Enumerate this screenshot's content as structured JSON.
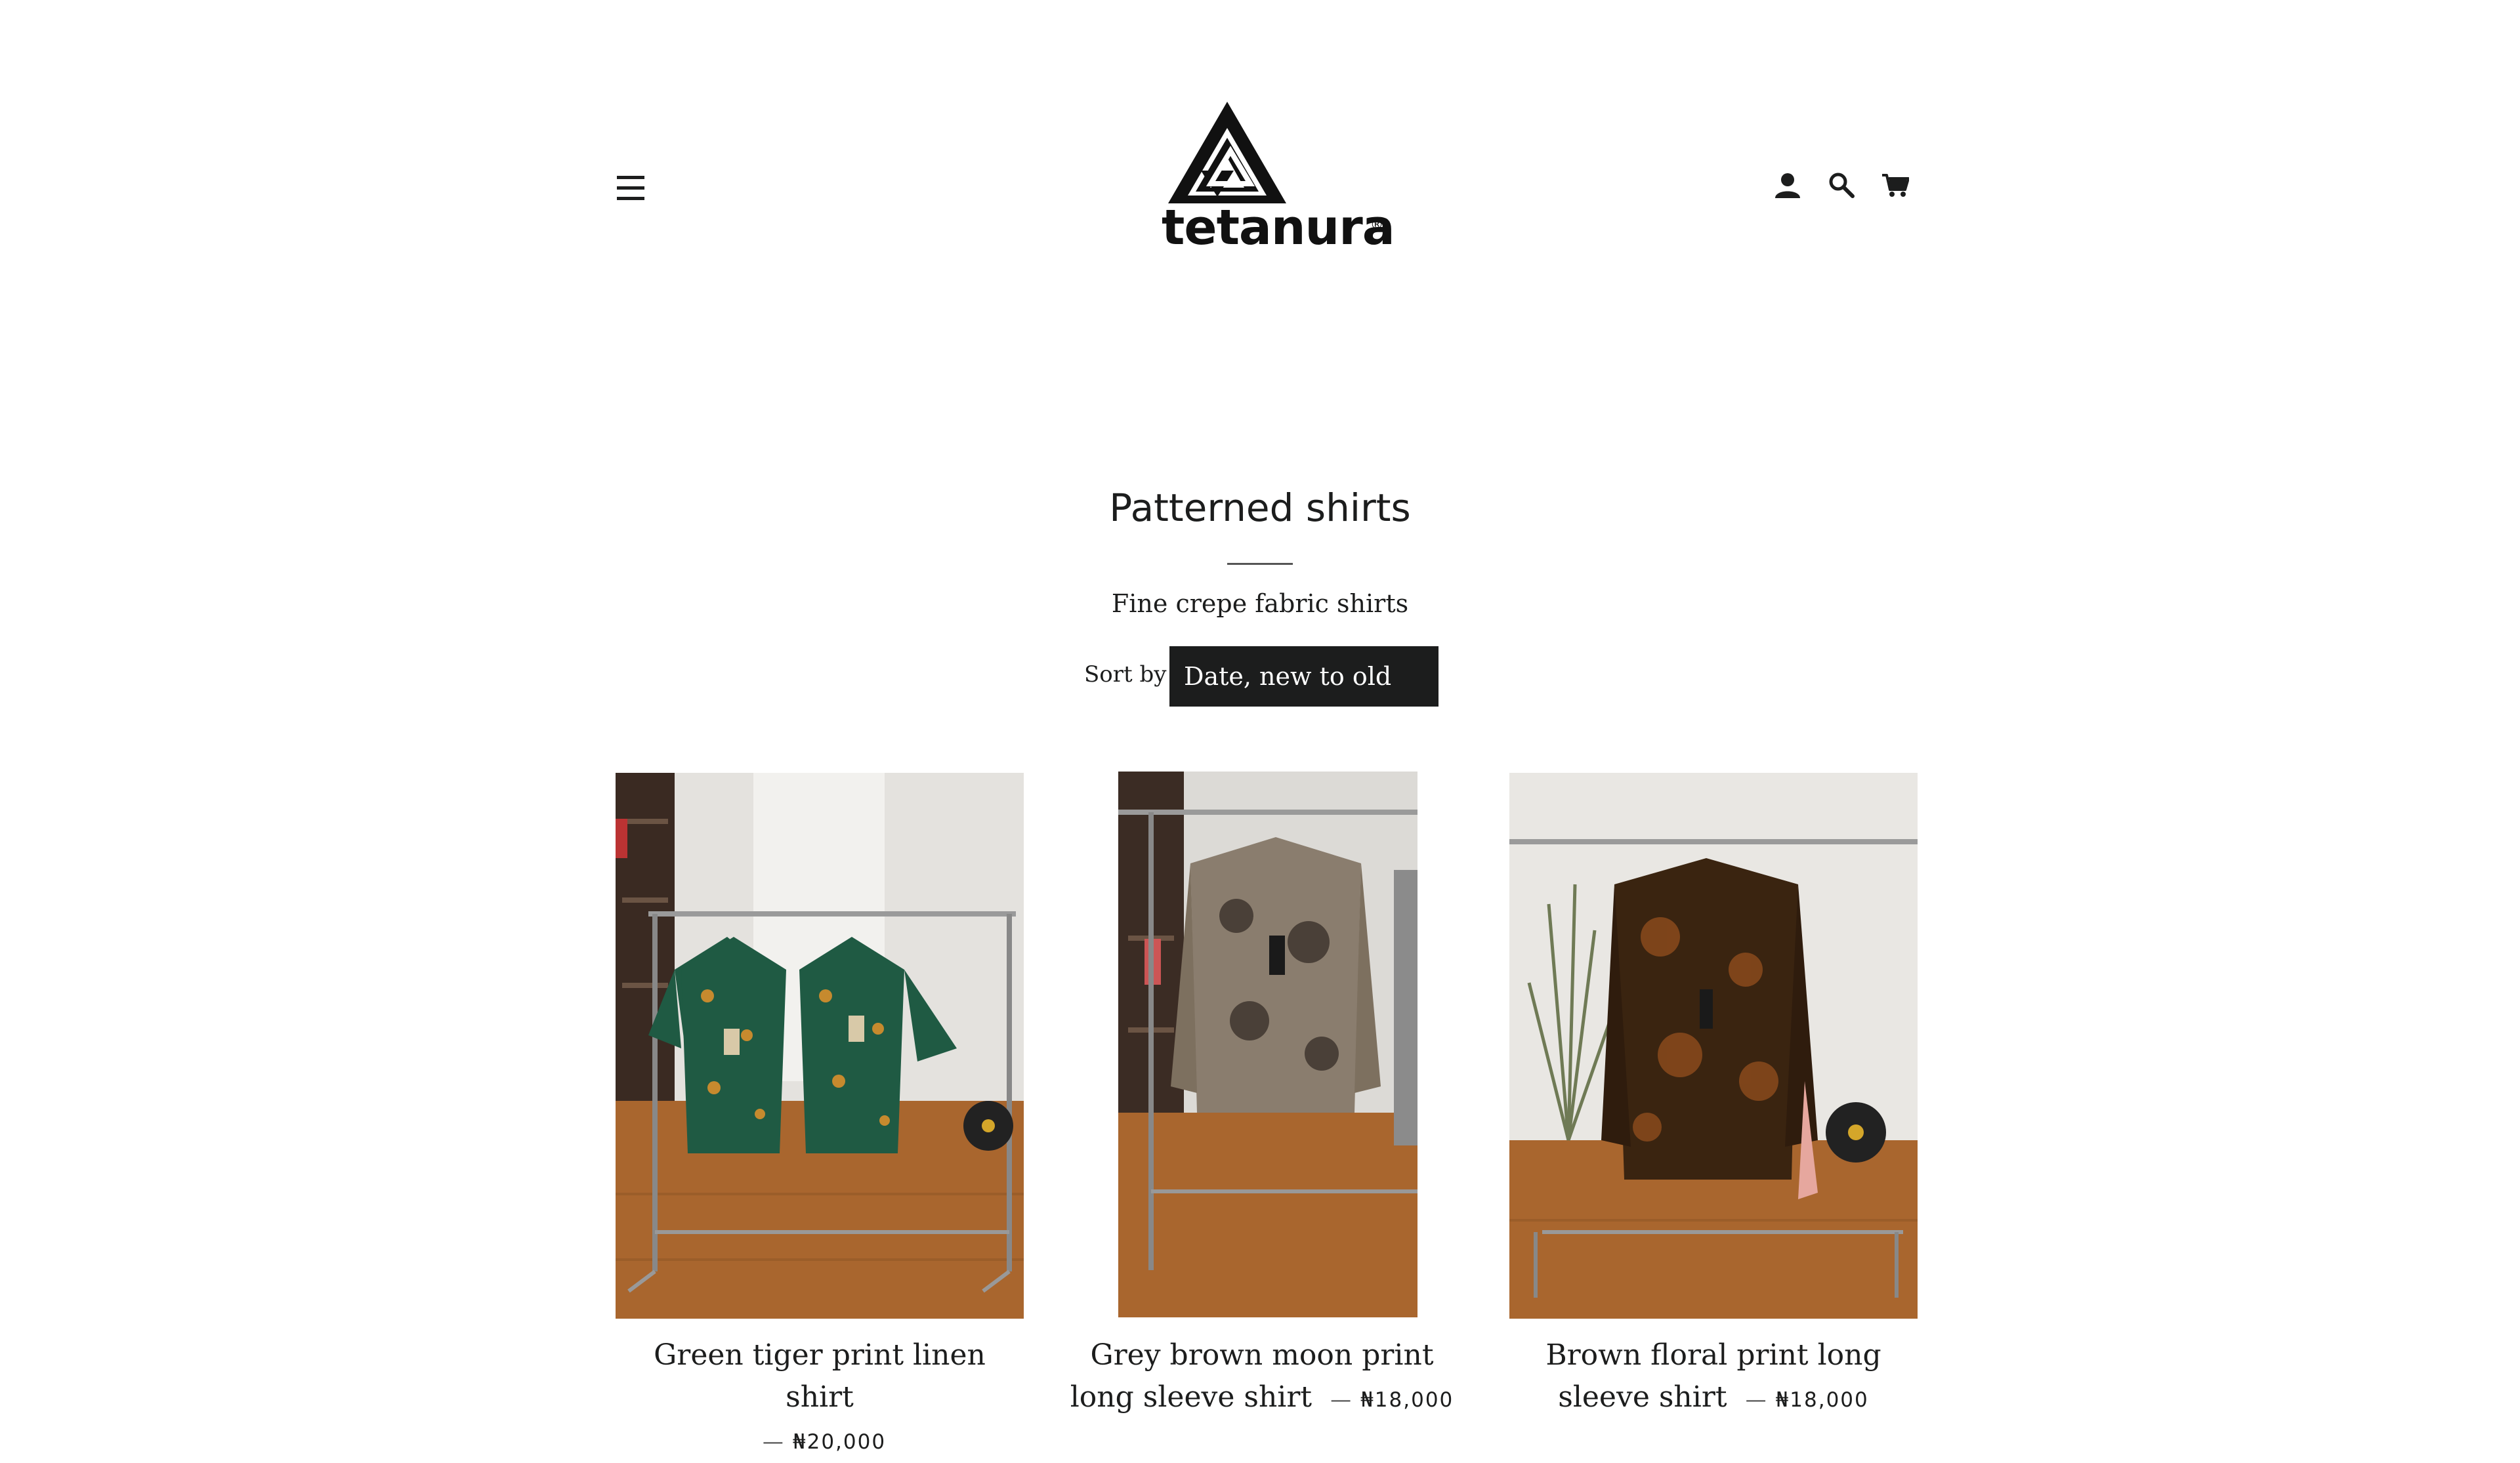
{
  "header": {
    "menu_icon": "hamburger-menu-icon",
    "logo_text": "tetanura",
    "logo_mark": "®",
    "icons": [
      "account-icon",
      "search-icon",
      "cart-icon"
    ]
  },
  "collection": {
    "title": "Patterned shirts",
    "description": "Fine crepe fabric shirts",
    "sort_label": "Sort by",
    "sort_value": "Date, new to old"
  },
  "products": [
    {
      "title": "Green tiger print linen shirt",
      "price": "₦20,000",
      "separator": "—"
    },
    {
      "title": "Grey brown moon print long sleeve shirt",
      "price": "₦18,000",
      "separator": "—"
    },
    {
      "title": "Brown floral print long sleeve shirt",
      "price": "₦18,000",
      "separator": "—"
    }
  ],
  "colors": {
    "text": "#1c1d1d",
    "select_bg": "#1c1d1d",
    "floor": "#a9662e",
    "wall": "#e6e3df"
  }
}
